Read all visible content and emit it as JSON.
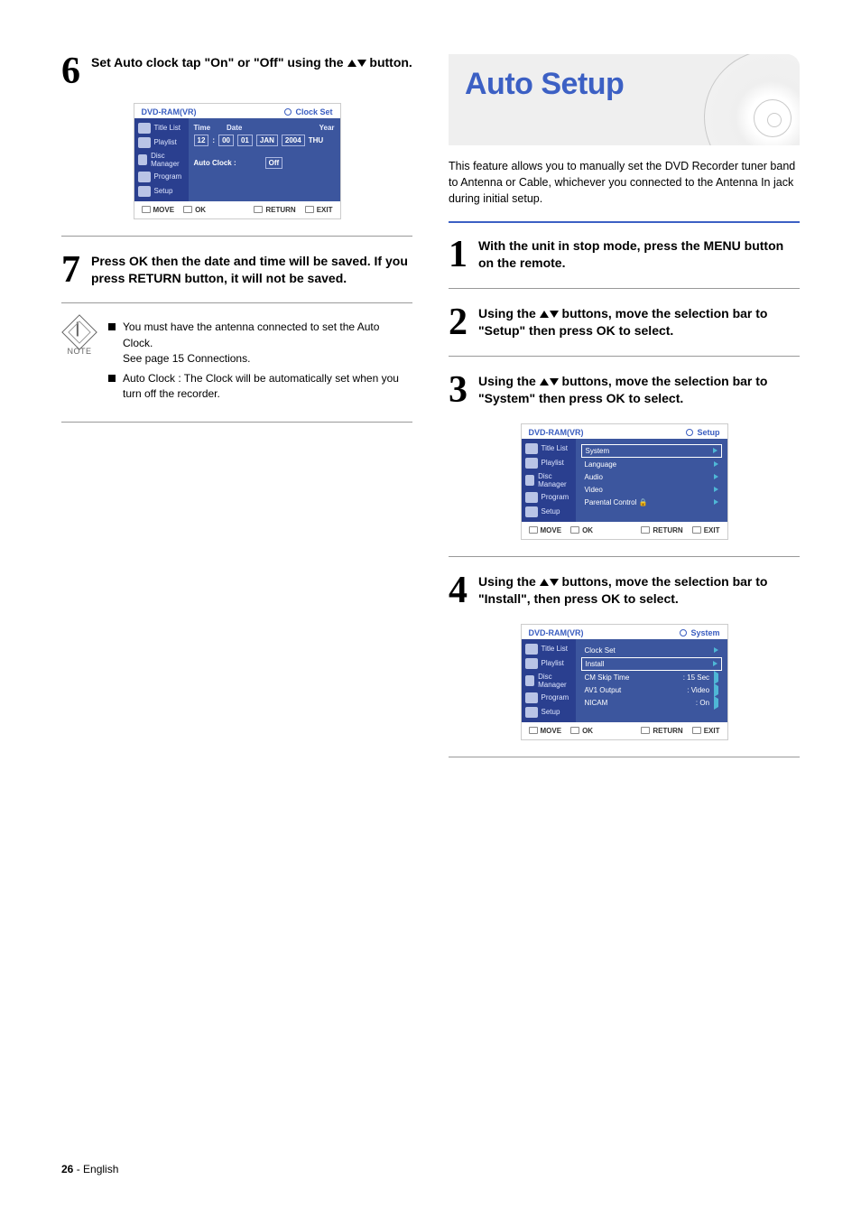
{
  "left": {
    "step6": {
      "num": "6",
      "text_a": "Set Auto clock tap \"On\" or \"Off\" using the ",
      "text_b": " button."
    },
    "osd_clock": {
      "header_left": "DVD-RAM(VR)",
      "header_right": "Clock Set",
      "side": [
        "Title List",
        "Playlist",
        "Disc Manager",
        "Program",
        "Setup"
      ],
      "row_labels": {
        "time": "Time",
        "date": "Date",
        "year": "Year"
      },
      "values": {
        "hh": "12",
        "mm": "00",
        "day": "01",
        "mon": "JAN",
        "year": "2004",
        "dow": "THU"
      },
      "auto_label": "Auto Clock :",
      "auto_value": "Off",
      "footer": {
        "move": "MOVE",
        "ok": "OK",
        "return": "RETURN",
        "exit": "EXIT"
      }
    },
    "step7": {
      "num": "7",
      "text": "Press OK then the date and time will be saved. If you press RETURN button, it will not be saved."
    },
    "note": {
      "label": "NOTE",
      "b1": "You must have the antenna connected to set the Auto Clock.",
      "b1_sub": "See page 15 Connections.",
      "b2": "Auto Clock : The Clock will be automatically set when you turn off the recorder."
    }
  },
  "right": {
    "hero_title": "Auto Setup",
    "intro": "This feature allows you to manually set the DVD Recorder tuner band to Antenna or Cable, whichever you connected to the Antenna In jack during initial setup.",
    "step1": {
      "num": "1",
      "text": "With the unit in stop mode, press the MENU button on the remote."
    },
    "step2": {
      "num": "2",
      "text_a": "Using the ",
      "text_b": " buttons, move the selection bar to \"Setup\" then press OK to select."
    },
    "step3": {
      "num": "3",
      "text_a": "Using the ",
      "text_b": " buttons, move the selection bar to \"System\" then press OK to select."
    },
    "osd_setup": {
      "header_left": "DVD-RAM(VR)",
      "header_right": "Setup",
      "side": [
        "Title List",
        "Playlist",
        "Disc Manager",
        "Program",
        "Setup"
      ],
      "rows": [
        {
          "label": "System",
          "sel": true
        },
        {
          "label": "Language"
        },
        {
          "label": "Audio"
        },
        {
          "label": "Video"
        },
        {
          "label": "Parental Control  🔒"
        }
      ],
      "footer": {
        "move": "MOVE",
        "ok": "OK",
        "return": "RETURN",
        "exit": "EXIT"
      }
    },
    "step4": {
      "num": "4",
      "text_a": "Using the ",
      "text_b": " buttons, move the selection bar to \"Install\", then press OK to select."
    },
    "osd_system": {
      "header_left": "DVD-RAM(VR)",
      "header_right": "System",
      "side": [
        "Title List",
        "Playlist",
        "Disc Manager",
        "Program",
        "Setup"
      ],
      "rows": [
        {
          "label": "Clock Set",
          "val": ""
        },
        {
          "label": "Install",
          "val": "",
          "sel": true
        },
        {
          "label": "CM Skip Time",
          "val": ": 15 Sec"
        },
        {
          "label": "AV1 Output",
          "val": ": Video"
        },
        {
          "label": "NICAM",
          "val": ": On"
        }
      ],
      "footer": {
        "move": "MOVE",
        "ok": "OK",
        "return": "RETURN",
        "exit": "EXIT"
      }
    }
  },
  "footer": {
    "page": "26",
    "sep": " - ",
    "lang": "English"
  }
}
